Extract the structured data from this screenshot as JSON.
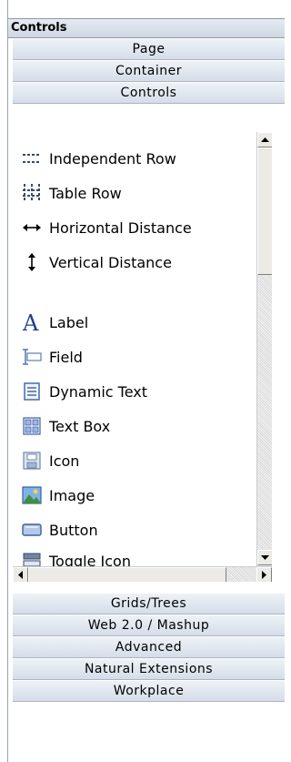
{
  "panel": {
    "title": "Controls",
    "sections_top": [
      "Page",
      "Container",
      "Controls"
    ],
    "sections_bottom": [
      "Grids/Trees",
      "Web 2.0 / Mashup",
      "Advanced",
      "Natural Extensions",
      "Workplace"
    ]
  },
  "items": [
    {
      "label": "Independent Row",
      "icon": "independent-row-icon"
    },
    {
      "label": "Table Row",
      "icon": "table-row-icon"
    },
    {
      "label": "Horizontal Distance",
      "icon": "horizontal-distance-icon"
    },
    {
      "label": "Vertical Distance",
      "icon": "vertical-distance-icon"
    },
    {
      "label": "Label",
      "icon": "label-icon"
    },
    {
      "label": "Field",
      "icon": "field-icon"
    },
    {
      "label": "Dynamic Text",
      "icon": "dynamic-text-icon"
    },
    {
      "label": "Text Box",
      "icon": "text-box-icon"
    },
    {
      "label": "Icon",
      "icon": "icon-icon"
    },
    {
      "label": "Image",
      "icon": "image-icon"
    },
    {
      "label": "Button",
      "icon": "button-icon"
    },
    {
      "label": "Toggle Icon",
      "icon": "toggle-icon-icon"
    }
  ],
  "colors": {
    "header_gradient_top": "#e6ebf2",
    "header_gradient_bottom": "#cfd7e2",
    "accent_blue": "#3a5fa8"
  }
}
